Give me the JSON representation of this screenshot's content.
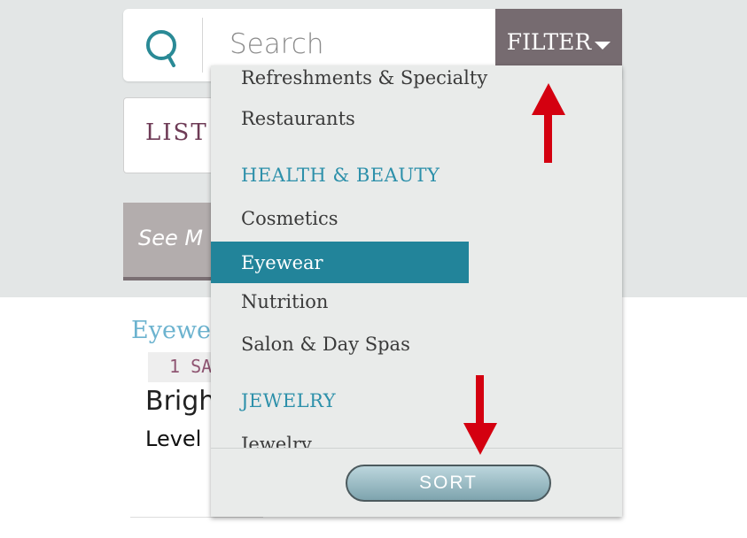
{
  "search": {
    "placeholder": "Search"
  },
  "filter": {
    "label": "FILTER"
  },
  "tabs": {
    "list_label": "LIST"
  },
  "see_more": {
    "label": "See M"
  },
  "result": {
    "name": "Eyewe",
    "badge": "1 SA",
    "brand": "Brigh",
    "level": "Level"
  },
  "dropdown": {
    "items": [
      {
        "kind": "item",
        "label": "Refreshments & Specialty"
      },
      {
        "kind": "item",
        "label": "Restaurants"
      },
      {
        "kind": "header",
        "label": "HEALTH & BEAUTY"
      },
      {
        "kind": "item",
        "label": "Cosmetics"
      },
      {
        "kind": "item",
        "label": "Eyewear",
        "selected": true
      },
      {
        "kind": "item",
        "label": "Nutrition"
      },
      {
        "kind": "item",
        "label": "Salon & Day Spas"
      },
      {
        "kind": "header",
        "label": "JEWELRY"
      },
      {
        "kind": "item",
        "label": "Jewelry"
      }
    ],
    "sort_label": "SORT"
  },
  "colors": {
    "filter_bg": "#766b70",
    "selected_bg": "#22849a",
    "header_text": "#2d90aa",
    "arrow": "#d40010"
  },
  "icons": [
    "search-icon",
    "chevron-down-icon",
    "arrow-up-icon",
    "arrow-down-icon"
  ]
}
